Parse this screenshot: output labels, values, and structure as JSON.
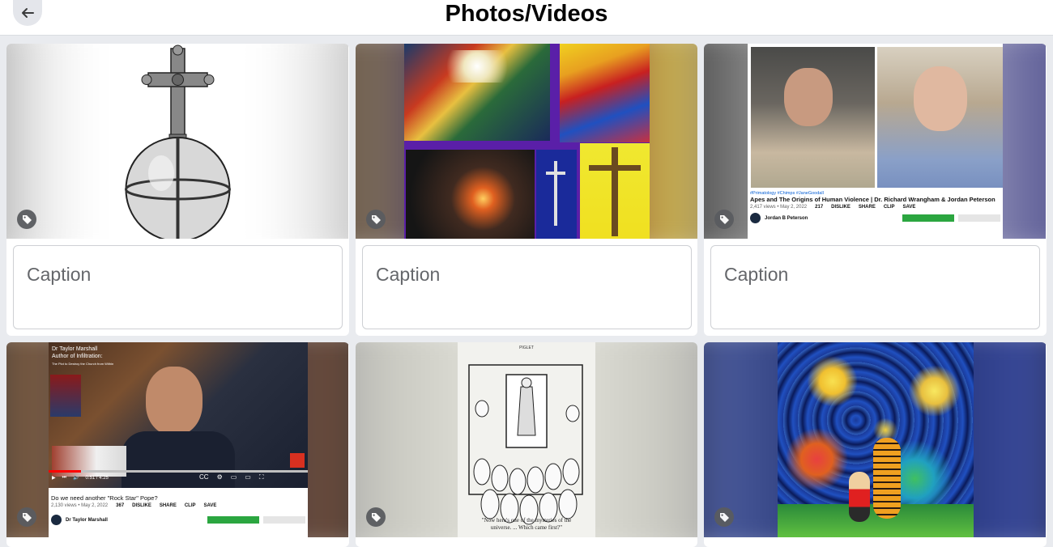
{
  "header": {
    "title": "Photos/Videos",
    "back_icon": "arrow-left-icon"
  },
  "caption_placeholder": "Caption",
  "items": [
    {
      "kind": "illustration",
      "subject": "cross-orb"
    },
    {
      "kind": "collage"
    },
    {
      "kind": "video-screenshot",
      "hashtags": "#Primatology #Chimps #JaneGoodall",
      "title": "Apes and The Origins of Human Violence | Dr. Richard Wrangham & Jordan Peterson",
      "stats": "2,417 views • May 2, 2022",
      "likes": "217",
      "dislike": "DISLIKE",
      "share": "SHARE",
      "clip": "CLIP",
      "save": "SAVE",
      "channel": "Jordan B Peterson"
    },
    {
      "kind": "video-screenshot",
      "overlay_lines": [
        "Dr Taylor Marshall",
        "Author of Infiltration:"
      ],
      "overlay_sub": "The Plot to Destroy the Church from Within",
      "time": "0:51 / 4:25",
      "title": "Do we need another \"Rock Star\" Pope?",
      "stats": "2,130 views • May 2, 2022",
      "likes": "367",
      "dislike": "DISLIKE",
      "share": "SHARE",
      "clip": "CLIP",
      "save": "SAVE",
      "channel": "Dr Taylor Marshall"
    },
    {
      "kind": "cartoon",
      "top_text": "PIGLET",
      "caption_line1": "\"Now here's one of the mysteries of the",
      "caption_line2": "universe. ... Which came first?\""
    },
    {
      "kind": "painting",
      "subject": "starry-night-calvin-hobbes"
    }
  ],
  "colors": {
    "accent": "#1877f2",
    "tag_bg": "#5a5c60",
    "page_bg": "#e9ebef"
  }
}
